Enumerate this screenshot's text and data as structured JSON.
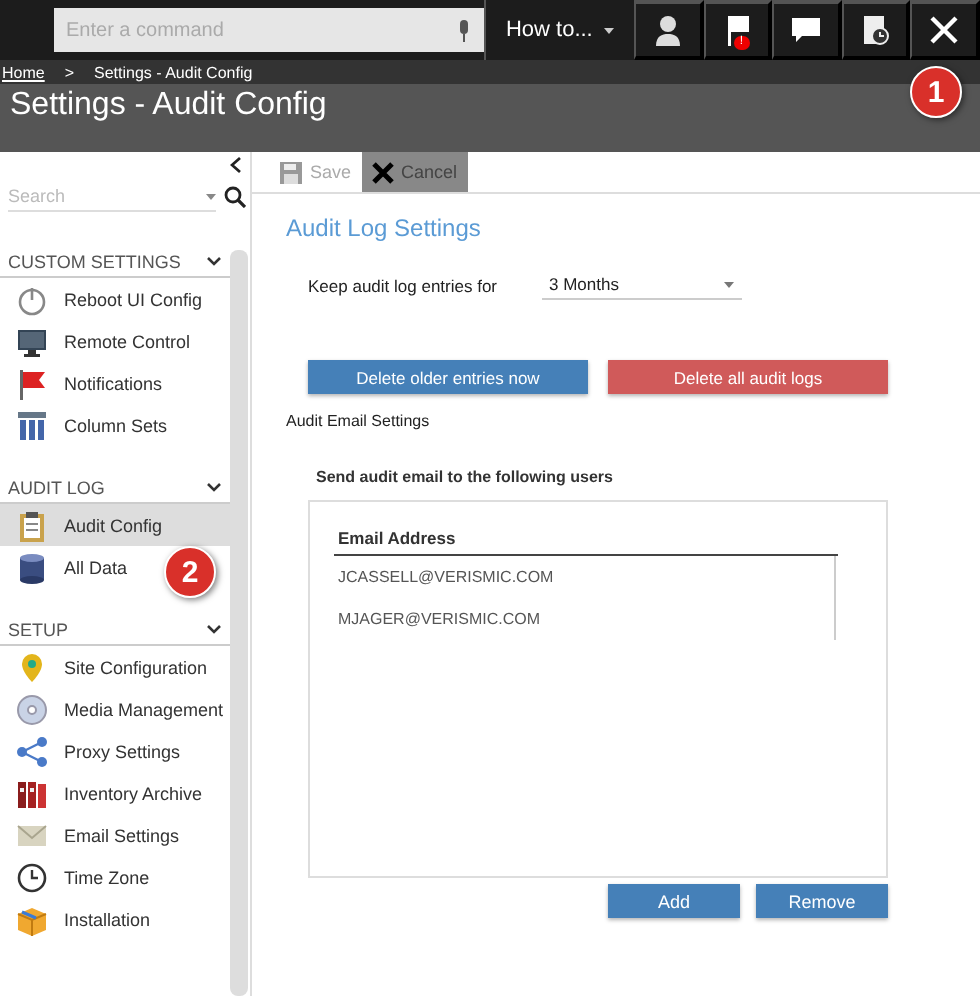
{
  "topbar": {
    "command": {
      "placeholder": "Enter a command"
    },
    "howto": "How to...",
    "flag_badge": "!"
  },
  "breadcrumb": {
    "home": "Home",
    "separator": ">",
    "current": "Settings - Audit Config"
  },
  "page_title": "Settings - Audit Config",
  "callouts": [
    "1",
    "2"
  ],
  "sidebar": {
    "search": {
      "placeholder": "Search"
    },
    "sections": [
      {
        "title": "CUSTOM SETTINGS",
        "expanded": true,
        "items": [
          {
            "label": "Reboot UI Config",
            "selected": false
          },
          {
            "label": "Remote Control",
            "selected": false
          },
          {
            "label": "Notifications",
            "selected": false
          },
          {
            "label": "Column Sets",
            "selected": false
          }
        ]
      },
      {
        "title": "AUDIT LOG",
        "expanded": true,
        "items": [
          {
            "label": "Audit Config",
            "selected": true
          },
          {
            "label": "All Data",
            "selected": false
          }
        ]
      },
      {
        "title": "SETUP",
        "expanded": true,
        "items": [
          {
            "label": "Site Configuration",
            "selected": false
          },
          {
            "label": "Media Management",
            "selected": false
          },
          {
            "label": "Proxy Settings",
            "selected": false
          },
          {
            "label": "Inventory Archive",
            "selected": false
          },
          {
            "label": "Email Settings",
            "selected": false
          },
          {
            "label": "Time Zone",
            "selected": false
          },
          {
            "label": "Installation",
            "selected": false
          }
        ]
      }
    ]
  },
  "toolbar": [
    {
      "label": "Save",
      "disabled": true,
      "pressed": false
    },
    {
      "label": "Cancel",
      "disabled": false,
      "pressed": true
    }
  ],
  "audit_log": {
    "heading": "Audit Log Settings",
    "keep_label": "Keep audit log entries for",
    "keep_value": "3 Months",
    "buttons": [
      {
        "label": "Delete older entries now",
        "kind": "primary"
      },
      {
        "label": "Delete all audit logs",
        "kind": "danger"
      }
    ]
  },
  "audit_email": {
    "heading": "Audit Email Settings",
    "instruction": "Send audit email to the following users",
    "table": {
      "columns": [
        "Email Address"
      ],
      "rows": [
        "JCASSELL@VERISMIC.COM",
        "MJAGER@VERISMIC.COM"
      ]
    },
    "buttons": [
      {
        "label": "Add"
      },
      {
        "label": "Remove"
      }
    ]
  }
}
